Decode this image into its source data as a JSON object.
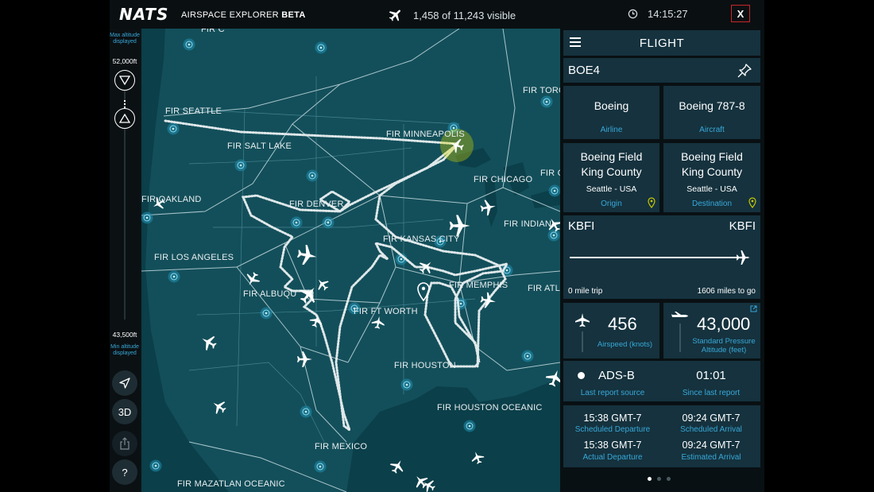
{
  "header": {
    "logo": "NATS",
    "app_title": "AIRSPACE EXPLORER",
    "app_badge": "BETA",
    "visible_count": "1,458 of 11,243 visible",
    "time": "14:15:27",
    "close_label": "X",
    "plane_icon": "plane-icon",
    "clock_icon": "clock-icon"
  },
  "altitude_filter": {
    "max_label": "Max altitude displayed",
    "max_value": "52,000ft",
    "min_label": "Min altitude displayed",
    "min_value": "43,500ft"
  },
  "tools": [
    {
      "name": "locate-button",
      "icon": "navigation-arrow-icon",
      "label": ""
    },
    {
      "name": "3d-button",
      "icon": "",
      "label": "3D"
    },
    {
      "name": "share-button",
      "icon": "share-icon",
      "label": ""
    },
    {
      "name": "help-button",
      "icon": "",
      "label": "?"
    }
  ],
  "map": {
    "regions": [
      "FIR SEATTLE",
      "FIR SALT LAKE",
      "FIR MINNEAPOLIS",
      "FIR TORO",
      "FIR CHICAGO",
      "FIR OAKLAND",
      "FIR DENVER",
      "FIR KANSAS CITY",
      "FIR INDIAN",
      "FIR LOS ANGELES",
      "FIR MEMPHIS",
      "FIR ATLA",
      "FIR ALBUQU",
      "FIR FT WORTH",
      "FIR HOUSTON",
      "FIR HOUSTON OCEANIC",
      "FIR MEXICO",
      "FIR MAZATLAN OCEANIC",
      "FIR C",
      "FIR CLEVELAND"
    ],
    "ocean_color": "#0b3f49",
    "land_color": "#134f5a",
    "track_color": "#dfe8ea",
    "highlight_color": "#d6d900"
  },
  "panel": {
    "title": "FLIGHT",
    "callsign": "BOE4",
    "airline": "Boeing",
    "airline_label": "Airline",
    "aircraft": "Boeing 787-8",
    "aircraft_label": "Aircraft",
    "origin_name_1": "Boeing Field",
    "origin_name_2": "King County",
    "origin_city": "Seattle - USA",
    "origin_label": "Origin",
    "dest_name_1": "Boeing Field",
    "dest_name_2": "King County",
    "dest_city": "Seattle - USA",
    "dest_label": "Destination",
    "from_code": "KBFI",
    "to_code": "KBFI",
    "trip": "0 mile trip",
    "to_go": "1606 miles to go",
    "progress": 1.0,
    "airspeed": "456",
    "airspeed_label": "Airspeed (knots)",
    "altitude": "43,000",
    "altitude_label_1": "Standard Pressure",
    "altitude_label_2": "Altitude (feet)",
    "source": "ADS-B",
    "source_label": "Last report source",
    "since": "01:01",
    "since_label": "Since last report",
    "sched_dep": "15:38 GMT-7",
    "sched_dep_label": "Scheduled Departure",
    "sched_arr": "09:24 GMT-7",
    "sched_arr_label": "Scheduled Arrival",
    "act_dep": "15:38 GMT-7",
    "act_dep_label": "Actual Departure",
    "est_arr": "09:24 GMT-7",
    "est_arr_label": "Estimated Arrival",
    "page": 1,
    "pages": 3
  }
}
